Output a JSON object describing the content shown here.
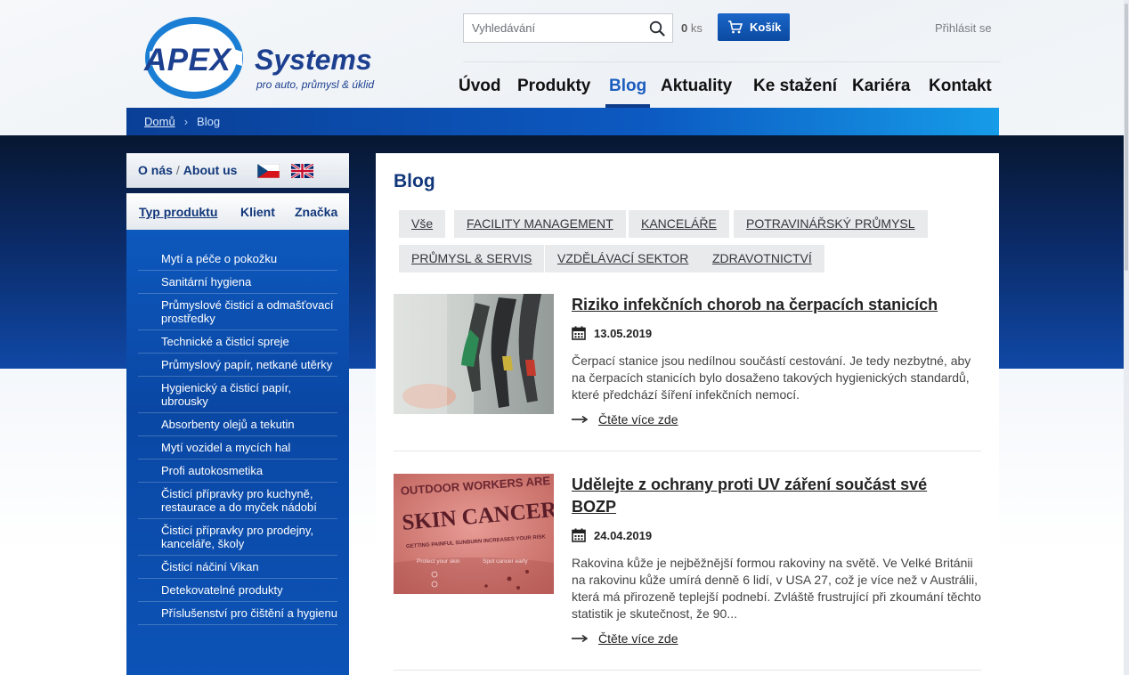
{
  "header": {
    "logo_brand": "APEX",
    "logo_name": "Systems",
    "logo_tagline": "pro auto, průmysl & úklid",
    "search_placeholder": "Vyhledávání",
    "cart_count_value": "0",
    "cart_count_unit": "ks",
    "cart_label": "Košík",
    "login_label": "Přihlásit se"
  },
  "nav": {
    "items": [
      "Úvod",
      "Produkty",
      "Blog",
      "Aktuality",
      "Ke stažení",
      "Kariéra",
      "Kontakt"
    ],
    "active": "Blog"
  },
  "breadcrumb": {
    "home": "Domů",
    "separator": "›",
    "current": "Blog"
  },
  "sidebar": {
    "about_cz": "O nás",
    "about_sep": "/",
    "about_en": "About us",
    "tabs": [
      "Typ produktu",
      "Klient",
      "Značka"
    ],
    "active_tab": "Typ produktu",
    "items": [
      "Mytí a péče o pokožku",
      "Sanitární hygiena",
      "Průmyslové čisticí a odmašťovací prostředky",
      "Technické a čisticí spreje",
      "Průmyslový papír, netkané utěrky",
      "Hygienický a čisticí papír, ubrousky",
      "Absorbenty olejů a tekutin",
      "Mytí vozidel a mycích hal",
      "Profi autokosmetika",
      "Čisticí přípravky pro kuchyně, restaurace a do myček nádobí",
      "Čisticí přípravky pro prodejny, kanceláře, školy",
      "Čisticí náčiní Vikan",
      "Detekovatelné produkty",
      "Příslušenství pro čištění a hygienu"
    ]
  },
  "main": {
    "title": "Blog",
    "filters": [
      "Vše",
      "FACILITY MANAGEMENT",
      "KANCELÁŘE",
      "POTRAVINÁŘSKÝ PRŮMYSL",
      "PRŮMYSL & SERVIS",
      "VZDĚLÁVACÍ SEKTOR",
      "ZDRAVOTNICTVÍ"
    ],
    "posts": [
      {
        "title": "Riziko infekčních chorob na čerpacích stanicích",
        "date": "13.05.2019",
        "excerpt": "Čerpací stanice jsou nedílnou součástí cestování. Je tedy nezbytné, aby na čerpacích stanicích bylo dosaženo takových hygienických standardů, které předchází šíření infekčních nemocí.",
        "more": "Čtěte více zde"
      },
      {
        "title": "Udělejte z ochrany proti UV záření součást své BOZP",
        "date": "24.04.2019",
        "excerpt": "Rakovina kůže je nejběžnější formou rakoviny na světě. Ve Velké Británii na rakovinu kůže umírá denně 6 lidí, v USA 27, což je více než v Austrálii, která má přirozeně teplejší podnebí. Zvláště frustrující při zkoumání těchto statistik je skutečnost, že 90...",
        "more": "Čtěte více zde",
        "image_text_top": "OUTDOOR WORKERS ARE AT GREATER RISK OF",
        "image_text_main": "SKIN CANCER.",
        "image_text_sub": "GETTING PAINFUL SUNBURN INCREASES YOUR RISK",
        "image_text_left": "Protect your skin",
        "image_text_right": "Spot cancer early"
      }
    ]
  },
  "colors": {
    "brand_blue": "#1c3f8f",
    "nav_active": "#1c5dbf",
    "cart_button": "#0b4aa1",
    "sidebar_blue": "#0a47a4",
    "dark_band": "#0b2a66"
  },
  "icons": {
    "search": "search-icon",
    "cart": "cart-icon",
    "calendar": "calendar-icon",
    "arrow": "arrow-right-icon",
    "flag_cz": "czech-flag-icon",
    "flag_en": "uk-flag-icon"
  }
}
